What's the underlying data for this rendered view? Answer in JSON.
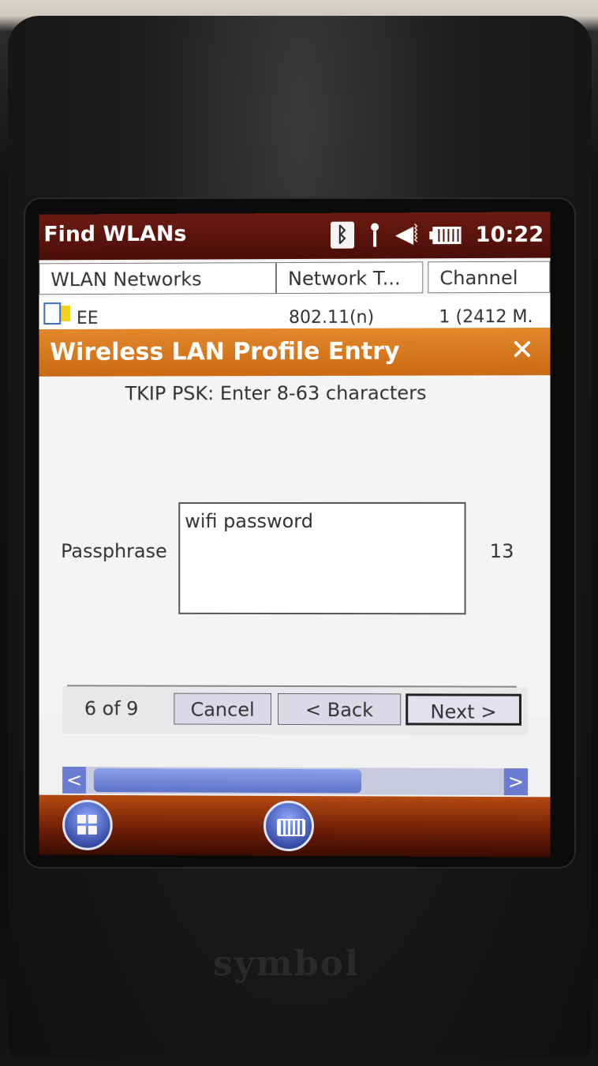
{
  "status_bar": {
    "app_title": "Find WLANs",
    "time": "10:22",
    "icons": [
      "bluetooth-icon",
      "signal-icon",
      "volume-icon",
      "battery-icon"
    ]
  },
  "list": {
    "columns": [
      "WLAN Networks",
      "Network T...",
      "Channel"
    ],
    "rows": [
      {
        "name": "EE",
        "type": "802.11(n)",
        "channel": "1 (2412 M."
      }
    ]
  },
  "dialog": {
    "title": "Wireless LAN Profile Entry",
    "close_glyph": "✕",
    "hint": "TKIP PSK: Enter 8-63 characters",
    "passphrase_label": "Passphrase",
    "passphrase_value": "wifi password",
    "char_count": "13",
    "step_counter": "6 of 9",
    "buttons": {
      "cancel": "Cancel",
      "back": "< Back",
      "next": "Next >"
    }
  },
  "scrollbar": {
    "left_glyph": "<",
    "right_glyph": ">"
  },
  "taskbar": {
    "icons": [
      "windows-start-icon",
      "keyboard-icon"
    ]
  },
  "colors": {
    "title_bar": "#5a140c",
    "dialog_header": "#d97a1f",
    "taskbar": "#8a2a0a",
    "scroll_thumb": "#6a7bd0"
  }
}
